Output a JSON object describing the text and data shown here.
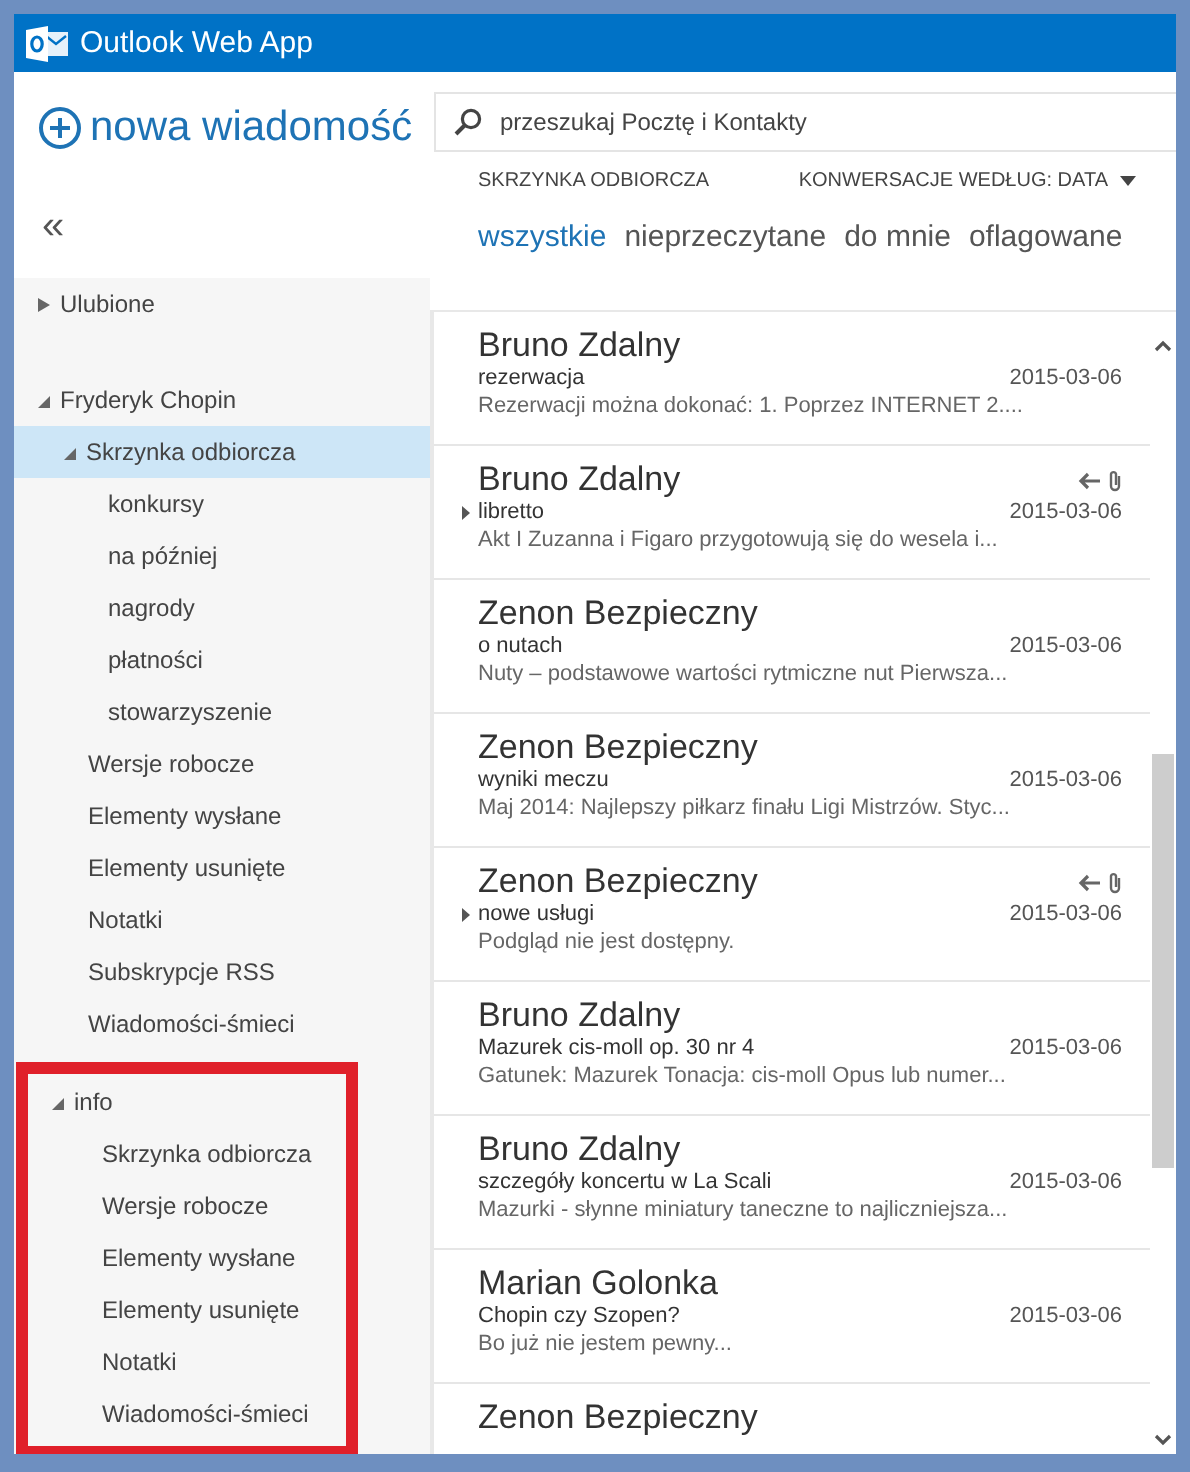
{
  "window": {
    "title": "Outlook Web App"
  },
  "new_message": {
    "label": "nowa wiadomość"
  },
  "collapse": {
    "label": "«"
  },
  "search": {
    "placeholder": "przeszukaj Pocztę i Kontakty"
  },
  "list_header": {
    "folder": "SKRZYNKA ODBIORCZA",
    "sort": "KONWERSACJE WEDŁUG: DATA"
  },
  "filters": [
    {
      "label": "wszystkie",
      "selected": true
    },
    {
      "label": "nieprzeczytane",
      "selected": false
    },
    {
      "label": "do mnie",
      "selected": false
    },
    {
      "label": "oflagowane",
      "selected": false
    }
  ],
  "folders": [
    {
      "label": "Ulubione",
      "expanded": false,
      "selected": false,
      "highlighted": false
    },
    {
      "label": "Fryderyk Chopin",
      "expanded": true,
      "selected": false,
      "highlighted": false,
      "children": [
        {
          "label": "Skrzynka odbiorcza",
          "expanded": true,
          "selected": true,
          "children": [
            {
              "label": "konkursy",
              "selected": false
            },
            {
              "label": "na później",
              "selected": false
            },
            {
              "label": "nagrody",
              "selected": false
            },
            {
              "label": "płatności",
              "selected": false
            },
            {
              "label": "stowarzyszenie",
              "selected": false
            }
          ]
        },
        {
          "label": "Wersje robocze",
          "selected": false
        },
        {
          "label": "Elementy wysłane",
          "selected": false
        },
        {
          "label": "Elementy usunięte",
          "selected": false
        },
        {
          "label": "Notatki",
          "selected": false
        },
        {
          "label": "Subskrypcje RSS",
          "selected": false
        },
        {
          "label": "Wiadomości-śmieci",
          "selected": false
        }
      ]
    },
    {
      "label": "info",
      "expanded": true,
      "selected": false,
      "highlighted": true,
      "children": [
        {
          "label": "Skrzynka odbiorcza",
          "selected": false
        },
        {
          "label": "Wersje robocze",
          "selected": false
        },
        {
          "label": "Elementy wysłane",
          "selected": false
        },
        {
          "label": "Elementy usunięte",
          "selected": false
        },
        {
          "label": "Notatki",
          "selected": false
        },
        {
          "label": "Wiadomości-śmieci",
          "selected": false
        }
      ]
    }
  ],
  "messages": [
    {
      "sender": "Bruno Zdalny",
      "subject": "rezerwacja",
      "date": "2015-03-06",
      "preview": "Rezerwacji można dokonać: 1. Poprzez INTERNET 2....",
      "thread": false,
      "replied": false,
      "attachment": false
    },
    {
      "sender": "Bruno Zdalny",
      "subject": "libretto",
      "date": "2015-03-06",
      "preview": "Akt I Zuzanna i Figaro przygotowują się do wesela i...",
      "thread": true,
      "replied": true,
      "attachment": true
    },
    {
      "sender": "Zenon Bezpieczny",
      "subject": "o nutach",
      "date": "2015-03-06",
      "preview": "Nuty – podstawowe wartości rytmiczne nut Pierwsza...",
      "thread": false,
      "replied": false,
      "attachment": false
    },
    {
      "sender": "Zenon Bezpieczny",
      "subject": "wyniki meczu",
      "date": "2015-03-06",
      "preview": "Maj 2014: Najlepszy piłkarz finału Ligi Mistrzów. Styc...",
      "thread": false,
      "replied": false,
      "attachment": false
    },
    {
      "sender": "Zenon Bezpieczny",
      "subject": "nowe usługi",
      "date": "2015-03-06",
      "preview": "Podgląd nie jest dostępny.",
      "thread": true,
      "replied": true,
      "attachment": true
    },
    {
      "sender": "Bruno Zdalny",
      "subject": "Mazurek cis-moll op. 30 nr 4",
      "date": "2015-03-06",
      "preview": "Gatunek: Mazurek Tonacja: cis-moll Opus lub numer...",
      "thread": false,
      "replied": false,
      "attachment": false
    },
    {
      "sender": "Bruno Zdalny",
      "subject": "szczegóły koncertu w La Scali",
      "date": "2015-03-06",
      "preview": "Mazurki - słynne miniatury taneczne to najliczniejsza...",
      "thread": false,
      "replied": false,
      "attachment": false
    },
    {
      "sender": "Marian Golonka",
      "subject": "Chopin czy Szopen?",
      "date": "2015-03-06",
      "preview": "Bo już nie jestem pewny...",
      "thread": false,
      "replied": false,
      "attachment": false
    },
    {
      "sender": "Zenon Bezpieczny",
      "thread": false,
      "replied": false,
      "attachment": false
    }
  ]
}
